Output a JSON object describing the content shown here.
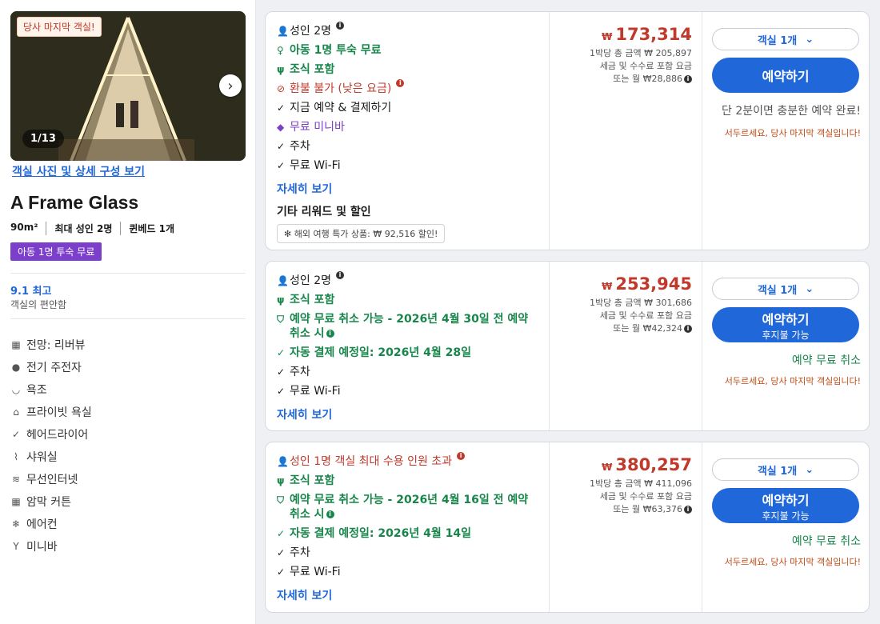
{
  "room": {
    "last_room_badge": "당사 마지막 객실!",
    "photo_counter": "1/13",
    "photos_link": "객실 사진 및 상세 구성 보기",
    "title": "A Frame Glass",
    "specs": [
      "90m²",
      "최대 성인 2명",
      "퀸베드 1개"
    ],
    "kid_badge": "아동 1명 투숙 무료",
    "score": "9.1 최고",
    "score_sub": "객실의 편안함",
    "amenities": [
      {
        "icon": "view-icon",
        "label": "전망: 리버뷰"
      },
      {
        "icon": "ev-charger-icon",
        "label": "전기 주전자"
      },
      {
        "icon": "bathtub-icon",
        "label": "욕조"
      },
      {
        "icon": "private-bath-icon",
        "label": "프라이빗 욕실"
      },
      {
        "icon": "hairdryer-icon",
        "label": "헤어드라이어"
      },
      {
        "icon": "shower-icon",
        "label": "샤워실"
      },
      {
        "icon": "wifi-icon",
        "label": "무선인터넷"
      },
      {
        "icon": "blackout-icon",
        "label": "암막 커튼"
      },
      {
        "icon": "aircon-icon",
        "label": "에어컨"
      },
      {
        "icon": "minibar-icon",
        "label": "미니바"
      }
    ]
  },
  "offers": [
    {
      "guests": "성인 2명",
      "kid_free": "아동 1명 투숙 무료",
      "breakfast": "조식 포함",
      "nonrefund": "환불 불가 (낮은 요금)",
      "pay_now": "지금 예약 & 결제하기",
      "minibar": "무료 미니바",
      "parking": "주차",
      "wifi": "무료 Wi-Fi",
      "more": "자세히 보기",
      "rewards_title": "기타 리워드 및 할인",
      "promo": "해외 여행 특가 상품: ₩ 92,516 할인!",
      "currency": "₩",
      "price": "173,314",
      "total": "1박당 총 금액 ₩ 205,897",
      "tax": "세금 및 수수료 포함 요금",
      "monthly": "또는 월 ₩28,886",
      "rooms_select": "객실 1개",
      "book": "예약하기",
      "fast": "단 2분이면 충분한 예약 완료!",
      "hurry": "서두르세요, 당사 마지막 객실입니다!"
    },
    {
      "guests": "성인 2명",
      "breakfast": "조식 포함",
      "free_cancel": "예약 무료 취소 가능 - 2026년 4월 30일 전 예약 취소 시",
      "auto_pay": "자동 결제 예정일: 2026년 4월 28일",
      "parking": "주차",
      "wifi": "무료 Wi-Fi",
      "more": "자세히 보기",
      "currency": "₩",
      "price": "253,945",
      "total": "1박당 총 금액 ₩ 301,686",
      "tax": "세금 및 수수료 포함 요금",
      "monthly": "또는 월 ₩42,324",
      "rooms_select": "객실 1개",
      "book": "예약하기",
      "book_sub": "후지불 가능",
      "cancel": "예약 무료 취소",
      "hurry": "서두르세요, 당사 마지막 객실입니다!"
    },
    {
      "guests": "성인 1명 객실 최대 수용 인원 초과",
      "breakfast": "조식 포함",
      "free_cancel": "예약 무료 취소 가능 - 2026년 4월 16일 전 예약 취소 시",
      "auto_pay": "자동 결제 예정일: 2026년 4월 14일",
      "parking": "주차",
      "wifi": "무료 Wi-Fi",
      "more": "자세히 보기",
      "currency": "₩",
      "price": "380,257",
      "total": "1박당 총 금액 ₩ 411,096",
      "tax": "세금 및 수수료 포함 요금",
      "monthly": "또는 월 ₩63,376",
      "rooms_select": "객실 1개",
      "book": "예약하기",
      "book_sub": "후지불 가능",
      "cancel": "예약 무료 취소",
      "hurry": "서두르세요, 당사 마지막 객실입니다!"
    }
  ],
  "colors": {
    "accent": "#2067da",
    "price": "#c0392b",
    "green": "#18864b",
    "purple": "#7b3fc9"
  }
}
